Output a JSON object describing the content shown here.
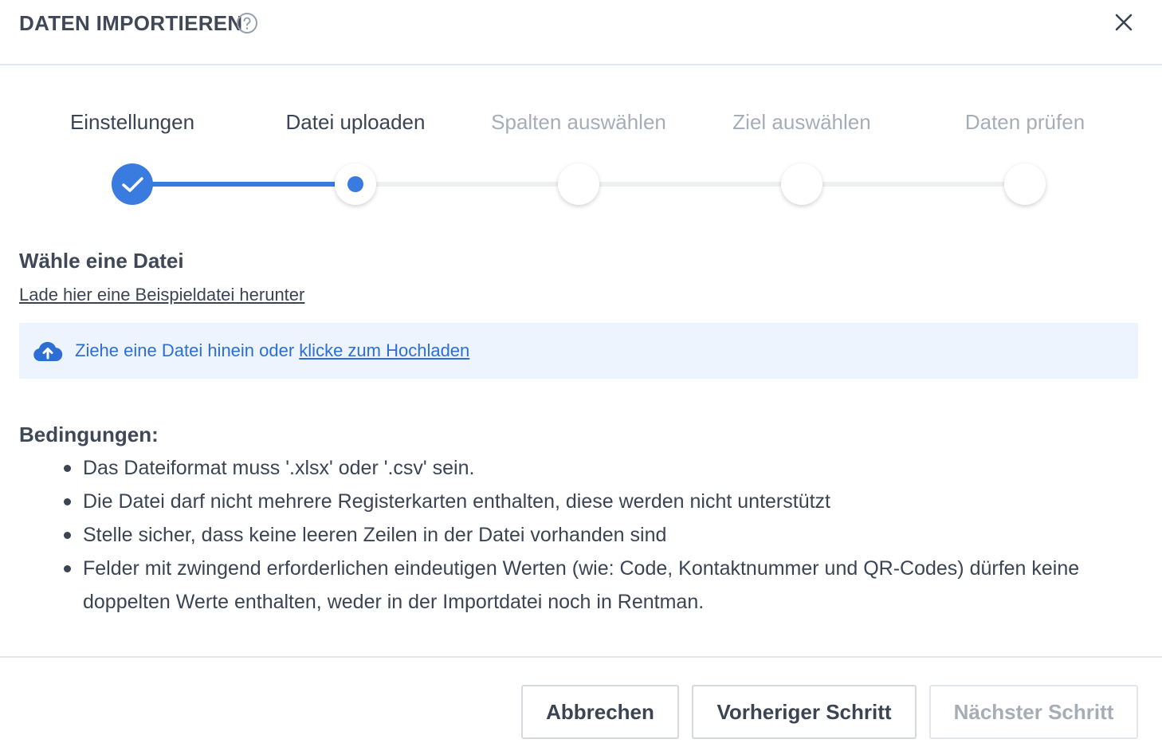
{
  "dialog": {
    "title": "DATEN IMPORTIEREN",
    "help_icon": "help-circle-icon",
    "close_icon": "close-icon"
  },
  "steps": [
    {
      "label": "Einstellungen",
      "state": "done"
    },
    {
      "label": "Datei uploaden",
      "state": "active"
    },
    {
      "label": "Spalten auswählen",
      "state": "pending"
    },
    {
      "label": "Ziel auswählen",
      "state": "pending"
    },
    {
      "label": "Daten prüfen",
      "state": "pending"
    }
  ],
  "upload": {
    "section_title": "Wähle eine Datei",
    "sample_link": "Lade hier eine Beispieldatei herunter",
    "drop_text": "Ziehe eine Datei hinein oder ",
    "drop_link": "klicke zum Hochladen",
    "icon": "cloud-upload-icon"
  },
  "conditions": {
    "title": "Bedingungen:",
    "items": [
      "Das Dateiformat muss '.xlsx' oder '.csv' sein.",
      "Die Datei darf nicht mehrere Registerkarten enthalten, diese werden nicht unterstützt",
      "Stelle sicher, dass keine leeren Zeilen in der Datei vorhanden sind",
      "Felder mit zwingend erforderlichen eindeutigen Werten (wie: Code, Kontaktnummer und QR-Codes) dürfen keine doppelten Werte enthalten, weder in der Importdatei noch in Rentman."
    ]
  },
  "footer": {
    "cancel_label": "Abbrechen",
    "previous_label": "Vorheriger Schritt",
    "next_label": "Nächster Schritt"
  },
  "colors": {
    "accent": "#3a7be0",
    "link": "#2d6ed5",
    "dropzone_bg": "#eef4fd",
    "muted_text": "#a7adb6"
  }
}
